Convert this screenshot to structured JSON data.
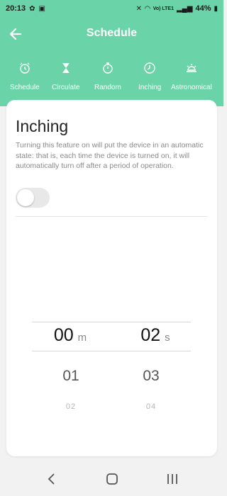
{
  "status": {
    "time": "20:13",
    "battery": "44%",
    "network_label": "Vo) LTE1"
  },
  "header": {
    "title": "Schedule"
  },
  "tabs": [
    {
      "label": "Schedule",
      "icon": "alarm-clock-icon"
    },
    {
      "label": "Circulate",
      "icon": "hourglass-icon"
    },
    {
      "label": "Random",
      "icon": "stopwatch-icon"
    },
    {
      "label": "Inching",
      "icon": "clock-icon",
      "active": true
    },
    {
      "label": "Astronomical",
      "icon": "sun-icon"
    }
  ],
  "card": {
    "title": "Inching",
    "description": "Turning this feature on will put the device in an automatic state: that is, each time the device is turned on, it will automatically turn off after a period of operation.",
    "toggle_on": false
  },
  "picker": {
    "minutes": {
      "selected": "00",
      "unit": "m",
      "next": "01",
      "next2": "02"
    },
    "seconds": {
      "selected": "02",
      "unit": "s",
      "next": "03",
      "next2": "04"
    }
  },
  "colors": {
    "header_bg": "#6ad4a8",
    "card_bg": "#ffffff",
    "page_bg": "#f2f2f2"
  }
}
